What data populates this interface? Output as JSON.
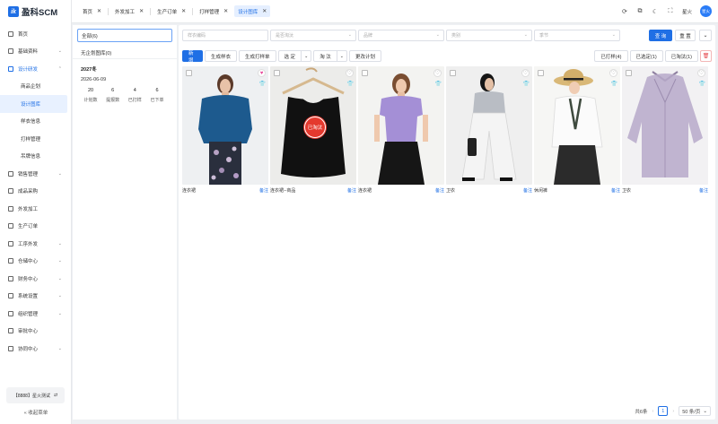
{
  "app": {
    "logo_mark": "ik",
    "name": "盈科SCM"
  },
  "sidebar": {
    "items": [
      {
        "label": "首页",
        "chevron": false
      },
      {
        "label": "基础资料",
        "chevron": true
      },
      {
        "label": "设计研发",
        "chevron": true,
        "open": true
      },
      {
        "label": "商品企划",
        "sub": true
      },
      {
        "label": "设计图库",
        "sub": true,
        "active": true
      },
      {
        "label": "样衣信息",
        "sub": true
      },
      {
        "label": "打样管理",
        "sub": true
      },
      {
        "label": "吊牌信息",
        "sub": true
      },
      {
        "label": "销售管理",
        "chevron": true
      },
      {
        "label": "成品采购",
        "chevron": false
      },
      {
        "label": "外发加工",
        "chevron": false
      },
      {
        "label": "生产订单",
        "chevron": false
      },
      {
        "label": "工序外发",
        "chevron": true
      },
      {
        "label": "仓储中心",
        "chevron": true
      },
      {
        "label": "财务中心",
        "chevron": true
      },
      {
        "label": "系统设置",
        "chevron": true
      },
      {
        "label": "组织管理",
        "chevron": true
      },
      {
        "label": "审批中心",
        "chevron": false
      },
      {
        "label": "协同中心",
        "chevron": true
      }
    ],
    "tenant": "【8888】星火测试",
    "collapse": "收起菜单"
  },
  "tabs": [
    {
      "label": "首页"
    },
    {
      "label": "外发加工"
    },
    {
      "label": "生产订单"
    },
    {
      "label": "打样管理"
    },
    {
      "label": "设计图库",
      "active": true
    }
  ],
  "header": {
    "user": "星火",
    "avatar": "星火"
  },
  "tree": {
    "all": "全部(6)",
    "none": "无企划图库(0)",
    "season": "2027冬",
    "date": "2026-06-09",
    "stats": [
      {
        "num": "20",
        "label": "计划数"
      },
      {
        "num": "6",
        "label": "提报数"
      },
      {
        "num": "4",
        "label": "已打样"
      },
      {
        "num": "6",
        "label": "已下单"
      }
    ]
  },
  "filters": {
    "style_no": "样衣编码",
    "status": "是否淘汰",
    "brand": "品牌",
    "category": "类别",
    "season": "季节",
    "query": "查 询",
    "reset": "重 置"
  },
  "toolbar": {
    "add": "新 增",
    "gen_sample": "生成样衣",
    "gen_proof": "生成打样单",
    "select": "选 定",
    "eliminate": "淘 汰",
    "change_plan": "更改计划",
    "proofed": "已打样(4)",
    "selected": "已选定(1)",
    "eliminated": "已淘汰(1)"
  },
  "cards": [
    {
      "name": "连衣裙",
      "note": "备注",
      "fav": true,
      "shirt": true,
      "stamp": ""
    },
    {
      "name": "连衣裙--商品",
      "note": "备注",
      "fav": false,
      "shirt": true,
      "stamp": "已淘汰"
    },
    {
      "name": "连衣裙",
      "note": "备注",
      "fav": false,
      "shirt": true,
      "stamp": ""
    },
    {
      "name": "卫衣",
      "note": "备注",
      "fav": false,
      "shirt": true,
      "stamp": ""
    },
    {
      "name": "休闲裤",
      "note": "备注",
      "fav": false,
      "shirt": true,
      "stamp": ""
    },
    {
      "name": "卫衣",
      "note": "备注",
      "fav": false,
      "shirt": false,
      "stamp": ""
    }
  ],
  "pager": {
    "total": "共6条",
    "page": "1",
    "size": "50 条/页"
  },
  "colors": {
    "accent": "#1f6fe5",
    "danger": "#e4392e"
  }
}
